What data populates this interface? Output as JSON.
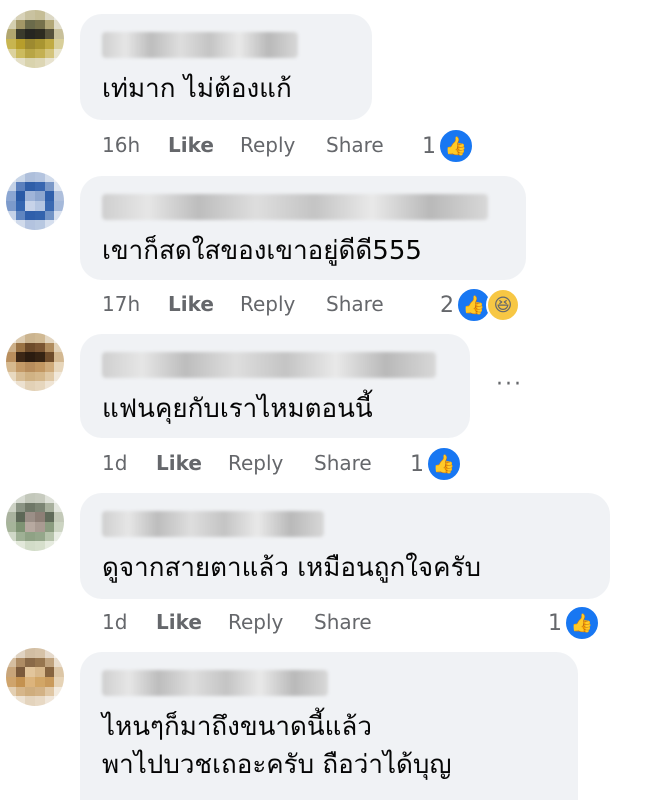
{
  "comments": [
    {
      "text": "เท่มาก ไม่ต้องแก้",
      "time": "16h",
      "like": "Like",
      "reply": "Reply",
      "share": "Share",
      "reaction_count": "1",
      "reactions": [
        "like-icon"
      ]
    },
    {
      "text": "เขาก็สดใสของเขาอยู่ดีดี555",
      "time": "17h",
      "like": "Like",
      "reply": "Reply",
      "share": "Share",
      "reaction_count": "2",
      "reactions": [
        "like-icon",
        "haha-icon"
      ]
    },
    {
      "text": "แฟนคุยกับเราไหมตอนนี้",
      "time": "1d",
      "like": "Like",
      "reply": "Reply",
      "share": "Share",
      "reaction_count": "1",
      "reactions": [
        "like-icon"
      ],
      "more": "···"
    },
    {
      "text": "ดูจากสายตาแล้ว เหมือนถูกใจครับ",
      "time": "1d",
      "like": "Like",
      "reply": "Reply",
      "share": "Share",
      "reaction_count": "1",
      "reactions": [
        "like-icon"
      ]
    },
    {
      "text": "ไหนๆก็มาถึงขนาดนี้แล้ว\nพาไปบวชเถอะครับ ถือว่าได้บุญ"
    }
  ],
  "colors": {
    "bubble": "#f0f2f5",
    "meta": "#65676b",
    "like": "#1877f2"
  }
}
